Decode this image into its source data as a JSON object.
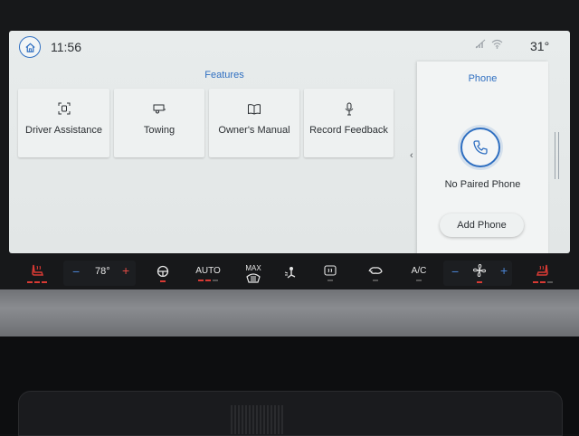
{
  "status_bar": {
    "time": "11:56",
    "outside_temp": "31°"
  },
  "features": {
    "title": "Features",
    "tiles": [
      {
        "label": "Driver Assistance",
        "icon": "driver-assist-icon"
      },
      {
        "label": "Towing",
        "icon": "trailer-icon"
      },
      {
        "label": "Owner's Manual",
        "icon": "book-icon"
      },
      {
        "label": "Record Feedback",
        "icon": "microphone-icon"
      }
    ]
  },
  "phone": {
    "title": "Phone",
    "status": "No Paired Phone",
    "add_label": "Add Phone"
  },
  "climate": {
    "driver_temp": "78°",
    "auto_label": "AUTO",
    "max_label": "MAX",
    "ac_label": "A/C",
    "minus": "−",
    "plus": "+"
  },
  "colors": {
    "accent": "#2f6fc1",
    "indicator_on": "#d83a34"
  }
}
